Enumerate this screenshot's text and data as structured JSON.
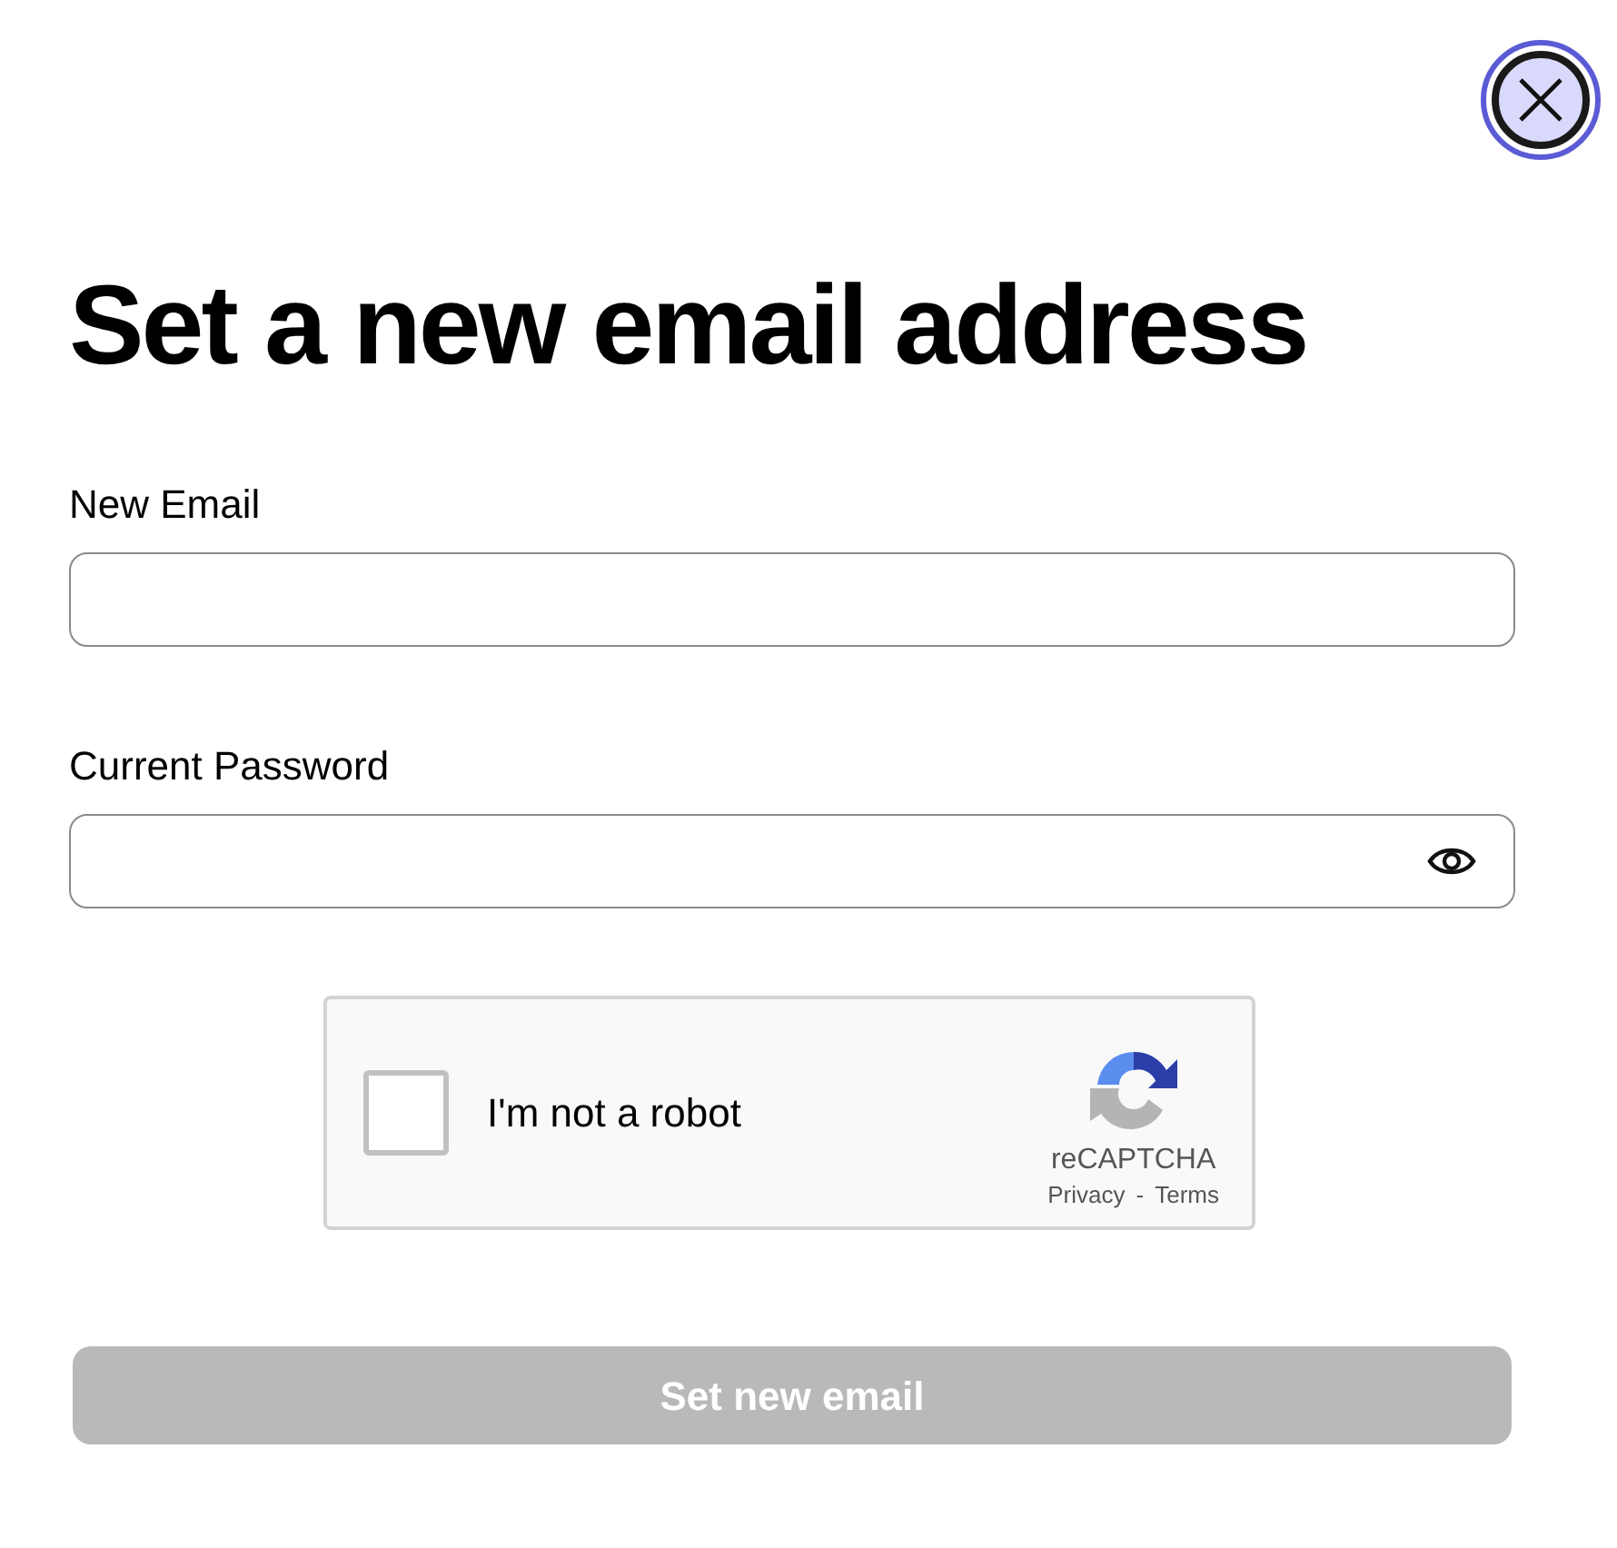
{
  "title": "Set a new email address",
  "fields": [
    {
      "label": "New Email",
      "kind": "text"
    },
    {
      "label": "Current Password",
      "kind": "password"
    }
  ],
  "captcha": {
    "label": "I'm not a robot",
    "checked": false,
    "brand": "reCAPTCHA",
    "privacy": "Privacy",
    "separator": "-",
    "terms": "Terms"
  },
  "submit": {
    "label": "Set new email",
    "disabled": true
  }
}
